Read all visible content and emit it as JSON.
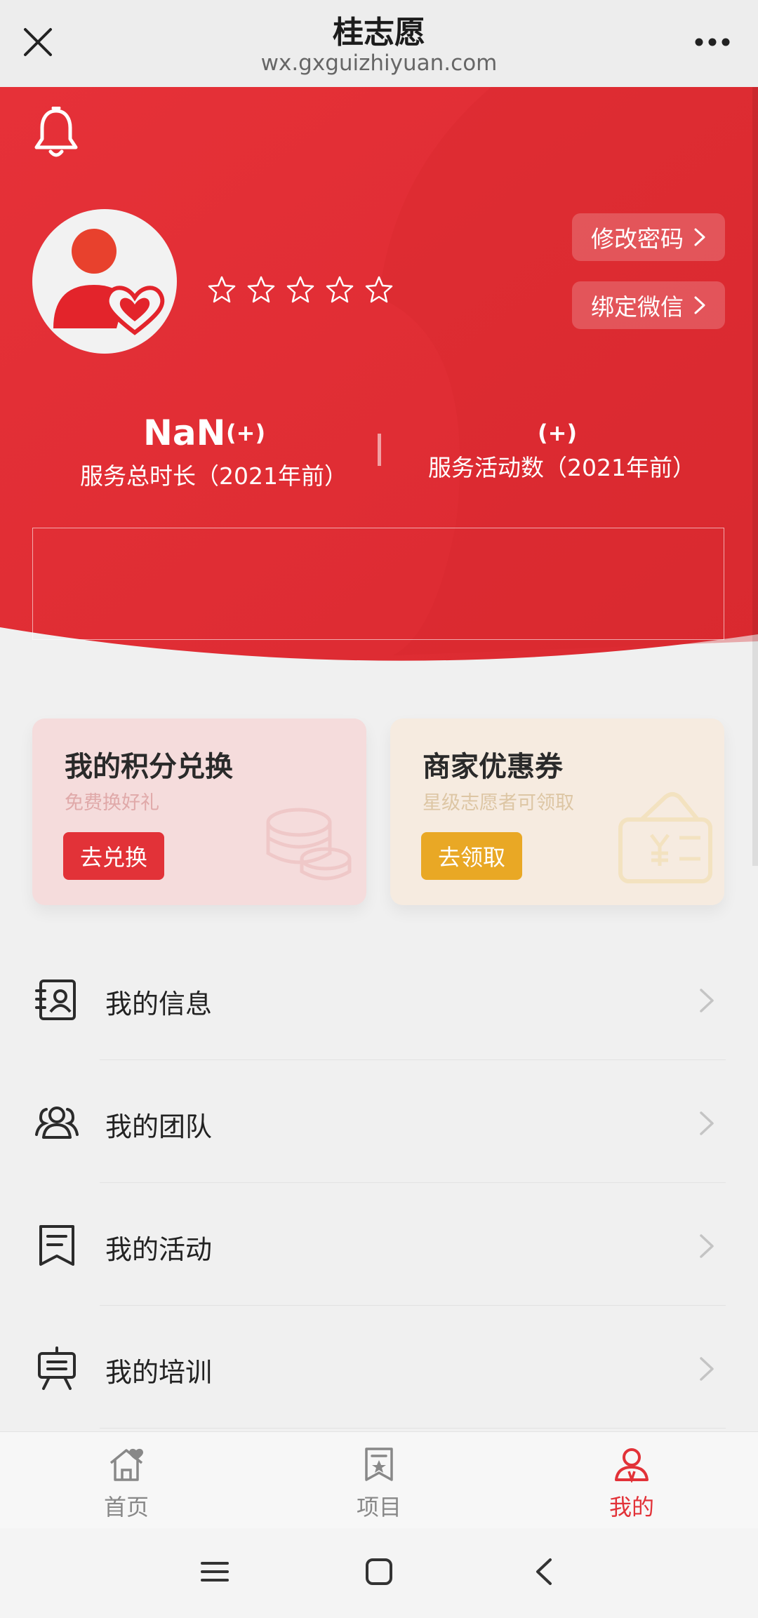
{
  "topbar": {
    "title": "桂志愿",
    "url": "wx.gxguizhiyuan.com"
  },
  "header": {
    "star_rating": 0,
    "star_total": 5,
    "buttons": {
      "change_password": "修改密码",
      "bind_wechat": "绑定微信"
    },
    "stats": {
      "hours_value": "NaN",
      "hours_plus": "(+)",
      "hours_label": "服务总时长（2021年前）",
      "activities_plus": "(+)",
      "activities_label": "服务活动数（2021年前）"
    }
  },
  "cards": {
    "points": {
      "title": "我的积分兑换",
      "subtitle": "免费换好礼",
      "button": "去兑换"
    },
    "coupon": {
      "title": "商家优惠券",
      "subtitle": "星级志愿者可领取",
      "button": "去领取"
    }
  },
  "menu": {
    "items": [
      {
        "label": "我的信息",
        "icon": "id-card-icon"
      },
      {
        "label": "我的团队",
        "icon": "team-icon"
      },
      {
        "label": "我的活动",
        "icon": "activity-icon"
      },
      {
        "label": "我的培训",
        "icon": "training-icon"
      }
    ]
  },
  "tabbar": {
    "home": "首页",
    "projects": "项目",
    "mine": "我的",
    "active": "mine"
  },
  "colors": {
    "brand_red": "#e23238",
    "coupon_yellow": "#e9a825"
  }
}
